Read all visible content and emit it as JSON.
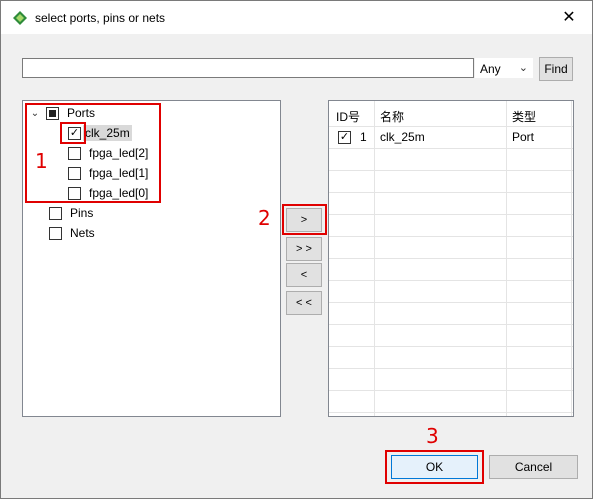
{
  "window": {
    "title": "select ports, pins or nets",
    "close_glyph": "✕",
    "icon": "green-diamond-icon"
  },
  "search": {
    "value": "",
    "placeholder": "",
    "scope": "Any",
    "find_label": "Find"
  },
  "tree": {
    "ports": {
      "label": "Ports",
      "state": "partial",
      "expanded": true
    },
    "port_items": [
      {
        "label": "clk_25m",
        "checked": true,
        "selected": true
      },
      {
        "label": "fpga_led[2]",
        "checked": false
      },
      {
        "label": "fpga_led[1]",
        "checked": false
      },
      {
        "label": "fpga_led[0]",
        "checked": false
      }
    ],
    "pins": {
      "label": "Pins",
      "checked": false
    },
    "nets": {
      "label": "Nets",
      "checked": false
    }
  },
  "move_buttons": {
    "add_one": ">",
    "add_all": "> >",
    "remove_one": "<",
    "remove_all": "< <"
  },
  "table": {
    "columns": [
      "ID号",
      "名称",
      "类型"
    ],
    "rows": [
      {
        "checked": true,
        "id": "1",
        "name": "clk_25m",
        "type": "Port"
      }
    ]
  },
  "footer": {
    "ok_label": "OK",
    "cancel_label": "Cancel"
  },
  "annotations": {
    "step1": "1",
    "step2": "2",
    "step3": "3",
    "color": "#e00000"
  }
}
